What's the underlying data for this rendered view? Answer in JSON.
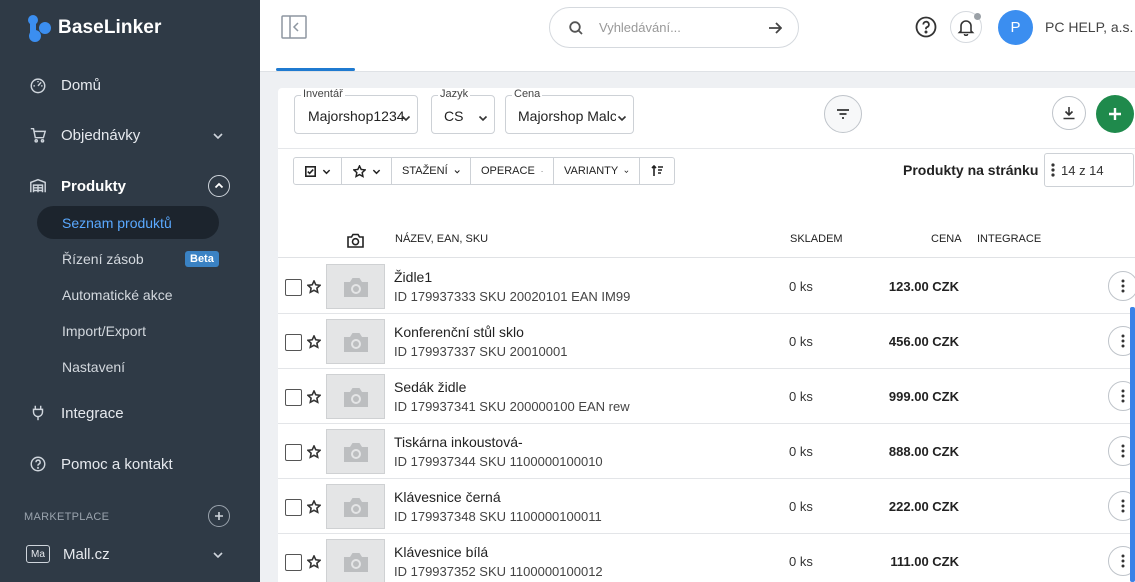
{
  "brand": {
    "name": "BaseLinker"
  },
  "sidebar": {
    "items": [
      {
        "label": "Domů",
        "icon": "dashboard-icon"
      },
      {
        "label": "Objednávky",
        "icon": "cart-icon"
      },
      {
        "label": "Produkty",
        "icon": "warehouse-icon"
      },
      {
        "label": "Integrace",
        "icon": "plug-icon"
      },
      {
        "label": "Pomoc a kontakt",
        "icon": "help-circle-icon"
      }
    ],
    "submenu": [
      {
        "label": "Seznam produktů"
      },
      {
        "label": "Řízení zásob",
        "badge": "Beta"
      },
      {
        "label": "Automatické akce"
      },
      {
        "label": "Import/Export"
      },
      {
        "label": "Nastavení"
      }
    ],
    "section_label": "MARKETPLACE",
    "marketplace": {
      "badge": "Ma",
      "label": "Mall.cz"
    }
  },
  "topbar": {
    "search_placeholder": "Vyhledávání...",
    "avatar_initial": "P",
    "account_name": "PC HELP, a.s."
  },
  "filters": {
    "inventory": {
      "label": "Inventář",
      "value": "Majorshop1234"
    },
    "language": {
      "label": "Jazyk",
      "value": "CS"
    },
    "price": {
      "label": "Cena",
      "value": "Majorshop Malc"
    }
  },
  "toolbar": {
    "download_label": "STAŽENÍ",
    "operations_label": "OPERACE",
    "variants_label": "VARIANTY",
    "per_page_label": "Produkty na stránku",
    "per_page_value": "14 z 14"
  },
  "table": {
    "headers": {
      "name": "NÁZEV, EAN, SKU",
      "stock": "SKLADEM",
      "price": "CENA",
      "integration": "INTEGRACE"
    },
    "rows": [
      {
        "name": "Židle1",
        "meta": "ID 179937333 SKU 20020101 EAN IM99",
        "stock": "0 ks",
        "price": "123.00 CZK"
      },
      {
        "name": "Konferenční stůl sklo",
        "meta": "ID 179937337 SKU 20010001",
        "stock": "0 ks",
        "price": "456.00 CZK"
      },
      {
        "name": "Sedák židle",
        "meta": "ID 179937341 SKU 200000100 EAN rew",
        "stock": "0 ks",
        "price": "999.00 CZK"
      },
      {
        "name": "Tiskárna inkoustová-",
        "meta": "ID 179937344 SKU 1100000100010",
        "stock": "0 ks",
        "price": "888.00 CZK"
      },
      {
        "name": "Klávesnice černá",
        "meta": "ID 179937348 SKU 1100000100011",
        "stock": "0 ks",
        "price": "222.00 CZK"
      },
      {
        "name": "Klávesnice bílá",
        "meta": "ID 179937352 SKU 1100000100012",
        "stock": "0 ks",
        "price": "111.00 CZK"
      }
    ]
  },
  "colors": {
    "sidebar_bg": "#2f3a46",
    "accent": "#1f7ad0",
    "add_button": "#1f8a4c",
    "active_link": "#5aa9ff"
  }
}
